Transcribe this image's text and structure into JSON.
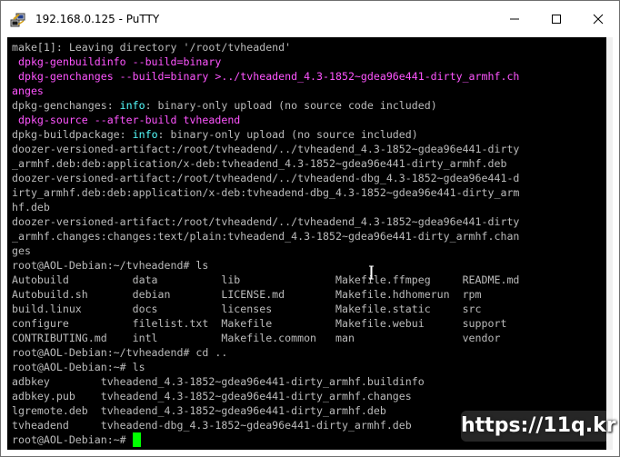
{
  "window": {
    "title": "192.168.0.125 - PuTTY",
    "icon": "putty-icon",
    "controls": [
      "minimize-icon",
      "maximize-icon",
      "close-icon"
    ]
  },
  "colors": {
    "terminal_bg": "#000000",
    "text": "#bbbbbb",
    "magenta": "#ff55ff",
    "cyan": "#55ffff",
    "cursor": "#00ff00"
  },
  "terminal": {
    "lines": [
      [
        {
          "t": "make[1]: Leaving directory '/root/tvheadend'"
        }
      ],
      [
        {
          "t": " dpkg-genbuildinfo --build=binary",
          "c": "magenta"
        }
      ],
      [
        {
          "t": " dpkg-genchanges --build=binary >../tvheadend_4.3-1852~gdea96e441-dirty_armhf.ch",
          "c": "magenta"
        }
      ],
      [
        {
          "t": "anges",
          "c": "magenta"
        }
      ],
      [
        {
          "t": "dpkg-genchanges: "
        },
        {
          "t": "info",
          "c": "cyan"
        },
        {
          "t": ": binary-only upload (no source code included)"
        }
      ],
      [
        {
          "t": " dpkg-source --after-build tvheadend",
          "c": "magenta"
        }
      ],
      [
        {
          "t": "dpkg-buildpackage: "
        },
        {
          "t": "info",
          "c": "cyan"
        },
        {
          "t": ": binary-only upload (no source included)"
        }
      ],
      [
        {
          "t": "doozer-versioned-artifact:/root/tvheadend/../tvheadend_4.3-1852~gdea96e441-dirty"
        }
      ],
      [
        {
          "t": "_armhf.deb:deb:application/x-deb:tvheadend_4.3-1852~gdea96e441-dirty_armhf.deb"
        }
      ],
      [
        {
          "t": "doozer-versioned-artifact:/root/tvheadend/../tvheadend-dbg_4.3-1852~gdea96e441-d"
        }
      ],
      [
        {
          "t": "irty_armhf.deb:deb:application/x-deb:tvheadend-dbg_4.3-1852~gdea96e441-dirty_arm"
        }
      ],
      [
        {
          "t": "hf.deb"
        }
      ],
      [
        {
          "t": "doozer-versioned-artifact:/root/tvheadend/../tvheadend_4.3-1852~gdea96e441-dirty"
        }
      ],
      [
        {
          "t": "_armhf.changes:changes:text/plain:tvheadend_4.3-1852~gdea96e441-dirty_armhf.chan"
        }
      ],
      [
        {
          "t": "ges"
        }
      ],
      [
        {
          "t": "root@AOL-Debian:~/tvheadend# ls"
        }
      ],
      [
        {
          "t": "Autobuild          data          lib               Makefile.ffmpeg     README.md"
        }
      ],
      [
        {
          "t": "Autobuild.sh       debian        LICENSE.md        Makefile.hdhomerun  rpm"
        }
      ],
      [
        {
          "t": "build.linux        docs          licenses          Makefile.static     src"
        }
      ],
      [
        {
          "t": "configure          filelist.txt  Makefile          Makefile.webui      support"
        }
      ],
      [
        {
          "t": "CONTRIBUTING.md    intl          Makefile.common   man                 vendor"
        }
      ],
      [
        {
          "t": "root@AOL-Debian:~/tvheadend# cd .."
        }
      ],
      [
        {
          "t": "root@AOL-Debian:~# ls"
        }
      ],
      [
        {
          "t": "adbkey        tvheadend_4.3-1852~gdea96e441-dirty_armhf.buildinfo"
        }
      ],
      [
        {
          "t": "adbkey.pub    tvheadend_4.3-1852~gdea96e441-dirty_armhf.changes"
        }
      ],
      [
        {
          "t": "lgremote.deb  tvheadend_4.3-1852~gdea96e441-dirty_armhf.deb"
        }
      ],
      [
        {
          "t": "tvheadend     tvheadend-dbg_4.3-1852~gdea96e441-dirty_armhf.deb"
        }
      ],
      [
        {
          "t": "root@AOL-Debian:~# "
        },
        {
          "cursor": true
        }
      ]
    ]
  },
  "watermark": "https://11q.kr"
}
